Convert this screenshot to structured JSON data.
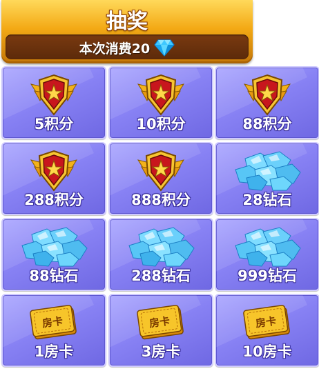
{
  "draw": {
    "title": "抽奖",
    "cost": "本次消费20",
    "cost_icon": "diamond-icon"
  },
  "rewards": [
    {
      "label": "5积分",
      "icon": "medal-icon"
    },
    {
      "label": "10积分",
      "icon": "medal-icon"
    },
    {
      "label": "88积分",
      "icon": "medal-icon"
    },
    {
      "label": "288积分",
      "icon": "medal-icon"
    },
    {
      "label": "888积分",
      "icon": "medal-icon"
    },
    {
      "label": "28钻石",
      "icon": "diamond-pile-icon"
    },
    {
      "label": "88钻石",
      "icon": "diamond-pile-icon"
    },
    {
      "label": "288钻石",
      "icon": "diamond-pile-icon"
    },
    {
      "label": "999钻石",
      "icon": "diamond-pile-icon"
    },
    {
      "label": "1房卡",
      "icon": "room-card-icon"
    },
    {
      "label": "3房卡",
      "icon": "room-card-icon"
    },
    {
      "label": "10房卡",
      "icon": "room-card-icon"
    }
  ],
  "room_card_text": "房卡"
}
